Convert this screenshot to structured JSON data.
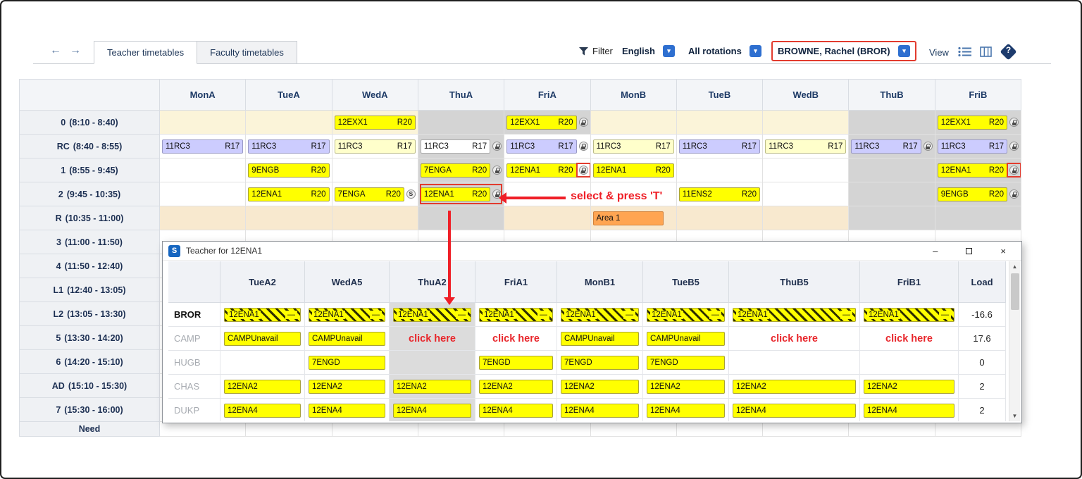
{
  "toolbar": {
    "tabs": [
      {
        "label": "Teacher timetables",
        "active": true
      },
      {
        "label": "Faculty timetables",
        "active": false
      }
    ],
    "filter_label": "Filter",
    "selects": [
      {
        "value": "English"
      },
      {
        "value": "All rotations"
      },
      {
        "value": "BROWNE, Rachel (BROR)",
        "highlighted": true
      }
    ],
    "view_label": "View"
  },
  "grid": {
    "day_headers": [
      "MonA",
      "TueA",
      "WedA",
      "ThuA",
      "FriA",
      "MonB",
      "TueB",
      "WedB",
      "ThuB",
      "FriB"
    ],
    "rows": [
      {
        "period": "0",
        "time": "(8:10 - 8:40)",
        "cells": [
          {
            "bg": "cream"
          },
          {
            "bg": "cream"
          },
          {
            "bg": "cream",
            "chip": {
              "c": "12EXX1",
              "r": "R20",
              "color": "yellow"
            }
          },
          {
            "bg": "gray"
          },
          {
            "bg": "gray",
            "chip": {
              "c": "12EXX1",
              "r": "R20",
              "color": "yellow"
            },
            "lock": true
          },
          {
            "bg": "cream"
          },
          {
            "bg": "cream"
          },
          {
            "bg": "cream"
          },
          {
            "bg": "gray"
          },
          {
            "bg": "gray",
            "chip": {
              "c": "12EXX1",
              "r": "R20",
              "color": "yellow"
            },
            "lock": true
          }
        ]
      },
      {
        "period": "RC",
        "time": "(8:40 - 8:55)",
        "cells": [
          {
            "chip": {
              "c": "11RC3",
              "r": "R17",
              "color": "lavender"
            }
          },
          {
            "chip": {
              "c": "11RC3",
              "r": "R17",
              "color": "lavender"
            }
          },
          {
            "chip": {
              "c": "11RC3",
              "r": "R17",
              "color": "cream"
            }
          },
          {
            "bg": "gray",
            "chip": {
              "c": "11RC3",
              "r": "R17",
              "color": "white"
            },
            "lock": true
          },
          {
            "chip": {
              "c": "11RC3",
              "r": "R17",
              "color": "lavender"
            },
            "lock": true
          },
          {
            "chip": {
              "c": "11RC3",
              "r": "R17",
              "color": "cream"
            }
          },
          {
            "chip": {
              "c": "11RC3",
              "r": "R17",
              "color": "lavender"
            }
          },
          {
            "chip": {
              "c": "11RC3",
              "r": "R17",
              "color": "cream"
            }
          },
          {
            "bg": "gray",
            "chip": {
              "c": "11RC3",
              "r": "R17",
              "color": "lavender"
            },
            "lock": true
          },
          {
            "bg": "gray",
            "chip": {
              "c": "11RC3",
              "r": "R17",
              "color": "lavender"
            },
            "lock": true
          }
        ]
      },
      {
        "period": "1",
        "time": "(8:55 - 9:45)",
        "cells": [
          null,
          {
            "chip": {
              "c": "9ENGB",
              "r": "R20",
              "color": "yellow"
            }
          },
          null,
          {
            "bg": "gray",
            "chip": {
              "c": "7ENGA",
              "r": "R20",
              "color": "yellow"
            },
            "lock": true
          },
          {
            "chip": {
              "c": "12ENA1",
              "r": "R20",
              "color": "yellow"
            },
            "lock": true,
            "lockbox": true
          },
          {
            "chip": {
              "c": "12ENA1",
              "r": "R20",
              "color": "yellow"
            }
          },
          null,
          null,
          {
            "bg": "gray"
          },
          {
            "bg": "gray",
            "chip": {
              "c": "12ENA1",
              "r": "R20",
              "color": "yellow"
            },
            "lock": true,
            "lockbox": true
          }
        ]
      },
      {
        "period": "2",
        "time": "(9:45 - 10:35)",
        "cells": [
          null,
          {
            "chip": {
              "c": "12ENA1",
              "r": "R20",
              "color": "yellow"
            }
          },
          {
            "chip": {
              "c": "7ENGA",
              "r": "R20",
              "color": "yellow"
            },
            "s": true
          },
          {
            "bg": "gray",
            "chip": {
              "c": "12ENA1",
              "r": "R20",
              "color": "yellow"
            },
            "lock": true,
            "redbox": true
          },
          null,
          null,
          {
            "chip": {
              "c": "11ENS2",
              "r": "R20",
              "color": "yellow"
            }
          },
          null,
          {
            "bg": "gray"
          },
          {
            "bg": "gray",
            "chip": {
              "c": "9ENGB",
              "r": "R20",
              "color": "yellow"
            },
            "lock": true
          }
        ]
      },
      {
        "period": "R",
        "time": "(10:35 - 11:00)",
        "cells": [
          {
            "bg": "peach"
          },
          {
            "bg": "peach"
          },
          {
            "bg": "peach"
          },
          {
            "bg": "gray"
          },
          {
            "bg": "peach"
          },
          {
            "bg": "peach",
            "chip": {
              "c": "Area 1",
              "r": "",
              "color": "orange"
            }
          },
          {
            "bg": "peach"
          },
          {
            "bg": "peach"
          },
          {
            "bg": "gray"
          },
          {
            "bg": "gray"
          }
        ]
      },
      {
        "period": "3",
        "time": "(11:00 - 11:50)",
        "cells": []
      },
      {
        "period": "4",
        "time": "(11:50 - 12:40)",
        "cells": []
      },
      {
        "period": "L1",
        "time": "(12:40 - 13:05)",
        "cells": []
      },
      {
        "period": "L2",
        "time": "(13:05 - 13:30)",
        "cells": []
      },
      {
        "period": "5",
        "time": "(13:30 - 14:20)",
        "cells": []
      },
      {
        "period": "6",
        "time": "(14:20 - 15:10)",
        "cells": []
      },
      {
        "period": "AD",
        "time": "(15:10 - 15:30)",
        "cells": []
      },
      {
        "period": "7",
        "time": "(15:30 - 16:00)",
        "cells": []
      },
      {
        "period": "Need",
        "time": "",
        "cells": [],
        "partial": true
      }
    ]
  },
  "annotations": {
    "select_press": "select & press 'T'",
    "click_here": "click here",
    "red": "#ef1f27"
  },
  "dialog": {
    "title": "Teacher for 12ENA1",
    "columns": [
      "TueA2",
      "WedA5",
      "ThuA2",
      "FriA1",
      "MonB1",
      "TueB5",
      "ThuB5",
      "FriB1"
    ],
    "load_header": "Load",
    "rows": [
      {
        "teacher": "BROR",
        "bold": true,
        "load": "-16.6",
        "cells": [
          {
            "chip": "12ENA1",
            "hatch": true
          },
          {
            "chip": "12ENA1",
            "hatch": true
          },
          {
            "chip": "12ENA1",
            "hatch": true
          },
          {
            "chip": "12ENA1",
            "hatch": true
          },
          {
            "chip": "12ENA1",
            "hatch": true
          },
          {
            "chip": "12ENA1",
            "hatch": true
          },
          {
            "chip": "12ENA1",
            "hatch": true
          },
          {
            "chip": "12ENA1",
            "hatch": true
          }
        ]
      },
      {
        "teacher": "CAMP",
        "load": "17.6",
        "cells": [
          {
            "chip": "CAMPUnavail"
          },
          {
            "chip": "CAMPUnavail"
          },
          {
            "click": true
          },
          {
            "click": true
          },
          {
            "chip": "CAMPUnavail"
          },
          {
            "chip": "CAMPUnavail"
          },
          {
            "click": true
          },
          {
            "click": true
          }
        ]
      },
      {
        "teacher": "HUGB",
        "load": "0",
        "cells": [
          null,
          {
            "chip": "7ENGD"
          },
          null,
          {
            "chip": "7ENGD"
          },
          {
            "chip": "7ENGD"
          },
          {
            "chip": "7ENGD"
          },
          null,
          null
        ]
      },
      {
        "teacher": "CHAS",
        "load": "2",
        "cells": [
          {
            "chip": "12ENA2"
          },
          {
            "chip": "12ENA2"
          },
          {
            "chip": "12ENA2"
          },
          {
            "chip": "12ENA2"
          },
          {
            "chip": "12ENA2"
          },
          {
            "chip": "12ENA2"
          },
          {
            "chip": "12ENA2"
          },
          {
            "chip": "12ENA2"
          }
        ]
      },
      {
        "teacher": "DUKP",
        "load": "2",
        "cells": [
          {
            "chip": "12ENA4"
          },
          {
            "chip": "12ENA4"
          },
          {
            "chip": "12ENA4"
          },
          {
            "chip": "12ENA4"
          },
          {
            "chip": "12ENA4"
          },
          {
            "chip": "12ENA4"
          },
          {
            "chip": "12ENA4"
          },
          {
            "chip": "12ENA4"
          }
        ]
      }
    ]
  }
}
